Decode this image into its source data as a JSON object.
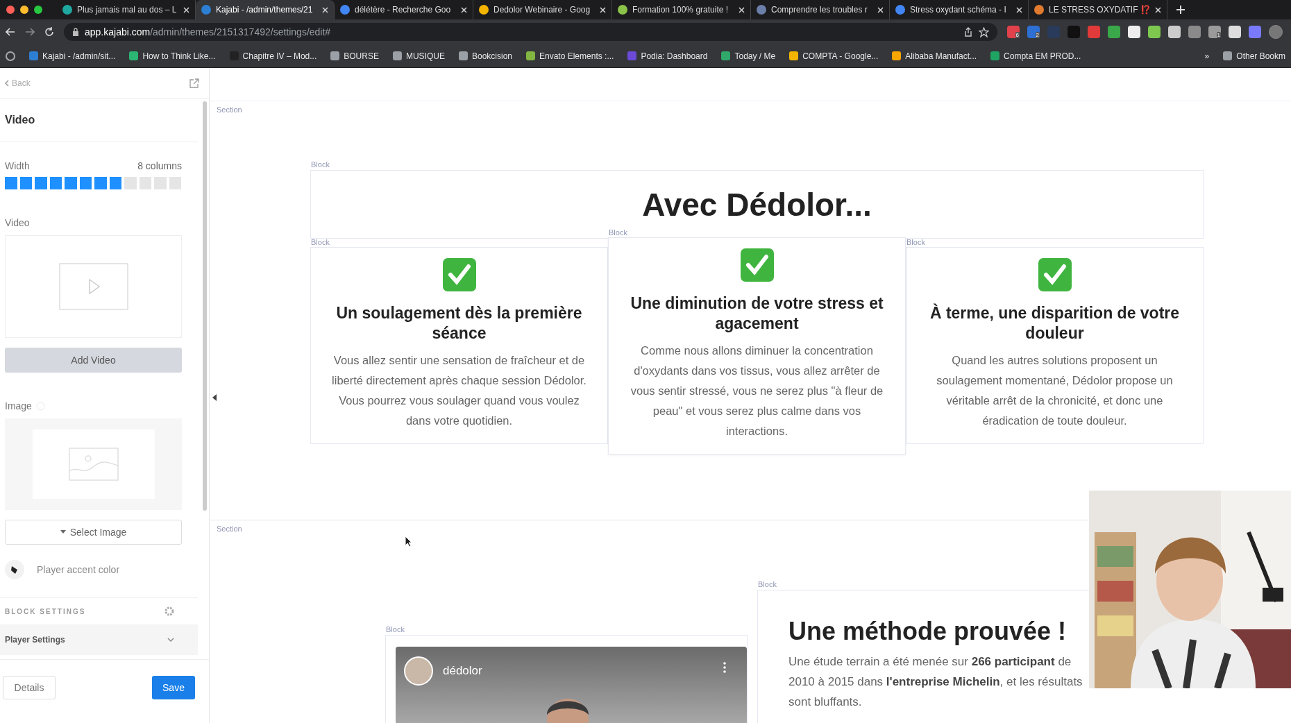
{
  "browser": {
    "tabs": [
      {
        "title": "Plus jamais mal au dos – L",
        "selected": false,
        "color": "#1fa8a0"
      },
      {
        "title": "Kajabi - /admin/themes/21",
        "selected": true,
        "color": "#2d7fd3"
      },
      {
        "title": "délétère - Recherche Goo",
        "selected": false,
        "color": "#4285f4"
      },
      {
        "title": "Dedolor Webinaire - Goog",
        "selected": false,
        "color": "#f4b400"
      },
      {
        "title": "Formation 100% gratuite !",
        "selected": false,
        "color": "#8bc34a"
      },
      {
        "title": "Comprendre les troubles r",
        "selected": false,
        "color": "#6b7fa8"
      },
      {
        "title": "Stress oxydant schéma - I",
        "selected": false,
        "color": "#4285f4"
      },
      {
        "title": "LE STRESS OXYDATIF ⁉️",
        "selected": false,
        "color": "#e07a2f"
      }
    ],
    "url": {
      "host": "app.kajabi.com",
      "path": "/admin/themes/2151317492/settings/edit#"
    },
    "extensions": [
      {
        "color": "#e0414b",
        "badge": "6"
      },
      {
        "color": "#2d6fd3",
        "badge": "2"
      },
      {
        "color": "#2a3a5a"
      },
      {
        "color": "#111111"
      },
      {
        "color": "#e03a3a"
      },
      {
        "color": "#3aa84a"
      },
      {
        "color": "#eeeeee"
      },
      {
        "color": "#7ec850"
      },
      {
        "color": "#cccccc"
      },
      {
        "color": "#8a8a8a"
      },
      {
        "color": "#9a9a9a",
        "badge": "1"
      },
      {
        "color": "#dddddd"
      },
      {
        "color": "#7a7aff"
      }
    ],
    "bookmarks": [
      {
        "label": "Kajabi - /admin/sit...",
        "color": "#2d7fd3"
      },
      {
        "label": "How to Think Like...",
        "color": "#2bb673"
      },
      {
        "label": "Chapitre IV – Mod...",
        "color": "#222222"
      },
      {
        "label": "BOURSE",
        "color": "#9aa0a6"
      },
      {
        "label": "MUSIQUE",
        "color": "#9aa0a6"
      },
      {
        "label": "Bookcision",
        "color": "#9aa0a6"
      },
      {
        "label": "Envato Elements :...",
        "color": "#82b541"
      },
      {
        "label": "Podia: Dashboard",
        "color": "#6c4ad8"
      },
      {
        "label": "Today / Me",
        "color": "#2fa86a"
      },
      {
        "label": "COMPTA - Google...",
        "color": "#f4b400"
      },
      {
        "label": "Alibaba Manufact...",
        "color": "#f7a600"
      },
      {
        "label": "Compta EM PROD...",
        "color": "#1fa463"
      }
    ],
    "more": "»",
    "other": "Other Bookm"
  },
  "sidebar": {
    "back": "Back",
    "title": "Video",
    "width": {
      "label": "Width",
      "value": "8 columns",
      "level": 0.6667
    },
    "video_label": "Video",
    "add_video": "Add Video",
    "image_label": "Image",
    "select_image": "Select Image",
    "accent": "Player accent color",
    "block_settings": "BLOCK SETTINGS",
    "player_settings": {
      "label": "Player Settings",
      "expanded": false
    },
    "details": "Details",
    "save": "Save"
  },
  "canvas": {
    "section_label": "Section",
    "heading_block_label": "Block",
    "heading": "Avec Dédolor...",
    "cards": [
      {
        "block_label": "Block",
        "title": "Un soulagement dès la première séance",
        "text": "Vous allez sentir une sensation de fraîcheur et de liberté directement après chaque session Dédolor. Vous pourrez vous soulager quand vous voulez dans votre quotidien.",
        "selected": false
      },
      {
        "block_label": "Block",
        "title": "Une diminution de votre stress et agacement",
        "text": "Comme nous allons diminuer la concentration d'oxydants dans vos tissus, vous allez arrêter de vous sentir stressé, vous ne serez plus \"à fleur de peau\" et vous serez plus calme dans vos interactions.",
        "selected": true
      },
      {
        "block_label": "Block",
        "title": "À terme, une disparition de votre douleur",
        "text": "Quand les autres solutions proposent un soulagement momentané, Dédolor propose un véritable arrêt de la chronicité, et donc une éradication de toute douleur.",
        "selected": false
      }
    ],
    "section2_label": "Section",
    "video": {
      "block_label": "Block",
      "channel": "dédolor"
    },
    "method": {
      "block_label": "Block",
      "heading": "Une méthode prouvée !",
      "text": "Une étude terrain a été menée sur **266 participant** de 2010 à 2015 dans **l'entreprise Michelin**, et les résultats sont bluffants."
    }
  }
}
